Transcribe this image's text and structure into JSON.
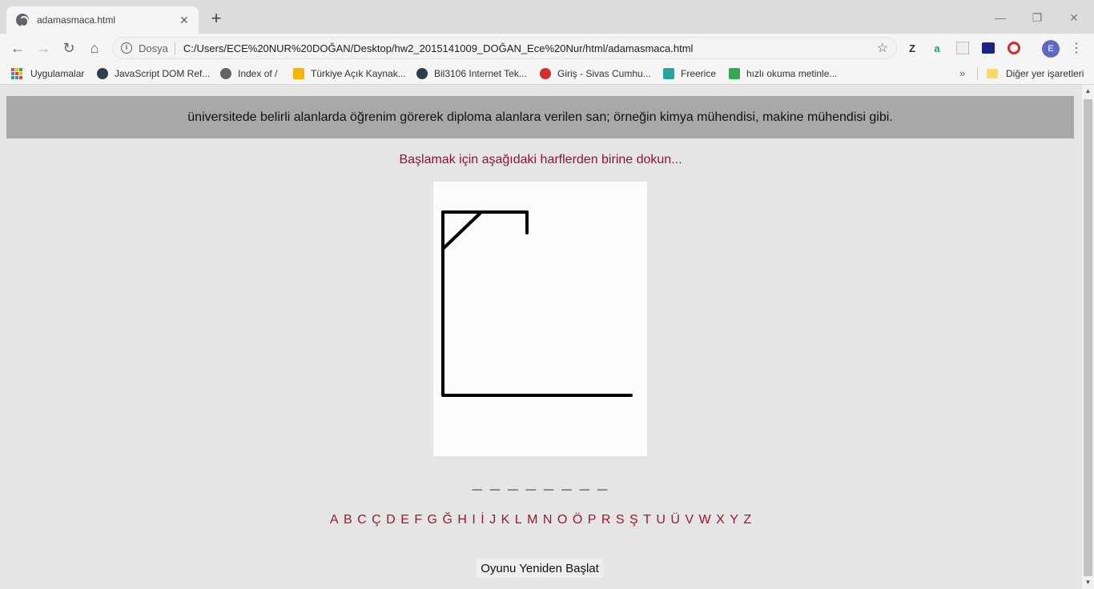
{
  "browser": {
    "tab_title": "adamasmaca.html",
    "tab_close": "✕",
    "new_tab": "+",
    "window_controls": {
      "minimize": "—",
      "restore": "❐",
      "close": "✕"
    },
    "nav": {
      "back": "←",
      "forward": "→",
      "reload": "↻",
      "home": "⌂"
    },
    "address": {
      "info_icon": "i",
      "chip": "Dosya",
      "url": "C:/Users/ECE%20NUR%20DOĞAN/Desktop/hw2_2015141009_DOĞAN_Ece%20Nur/html/adamasmaca.html",
      "star": "☆"
    },
    "extensions": [
      "Z",
      "a"
    ],
    "profile_initial": "E",
    "menu": "⋮"
  },
  "bookmarks": {
    "items": [
      {
        "label": "Uygulamalar"
      },
      {
        "label": "JavaScript DOM Ref...",
        "icon_color": "#2d3e4f"
      },
      {
        "label": "Index of /",
        "icon_color": "#5f6368"
      },
      {
        "label": "Türkiye Açık Kaynak...",
        "icon_color": "#f4b400"
      },
      {
        "label": "Bil3106 Internet Tek...",
        "icon_color": "#2d3e4f"
      },
      {
        "label": "Giriş - Sivas Cumhu...",
        "icon_color": "#d32f2f"
      },
      {
        "label": "Freerice",
        "icon_color": "#26a69a"
      },
      {
        "label": "hızlı okuma metinle...",
        "icon_color": "#34a853"
      }
    ],
    "more": "»",
    "other": "Diğer yer işaretleri"
  },
  "game": {
    "hint": "üniversitede belirli alanlarda öğrenim görerek diploma alanlara verilen san; örneğin kimya mühendisi, makine mühendisi gibi.",
    "prompt": "Başlamak için aşağıdaki harflerden birine dokun...",
    "blanks": "_ _ _ _ _ _ _ _",
    "letters": [
      "A",
      "B",
      "C",
      "Ç",
      "D",
      "E",
      "F",
      "G",
      "Ğ",
      "H",
      "I",
      "İ",
      "J",
      "K",
      "L",
      "M",
      "N",
      "O",
      "Ö",
      "P",
      "R",
      "S",
      "Ş",
      "T",
      "U",
      "Ü",
      "V",
      "W",
      "X",
      "Y",
      "Z"
    ],
    "restart_label": "Oyunu Yeniden Başlat"
  },
  "colors": {
    "hint_bg": "#a8a8a8",
    "prompt": "#8b1538",
    "letters": "#a0162b",
    "page_bg": "#e5e5e5"
  }
}
